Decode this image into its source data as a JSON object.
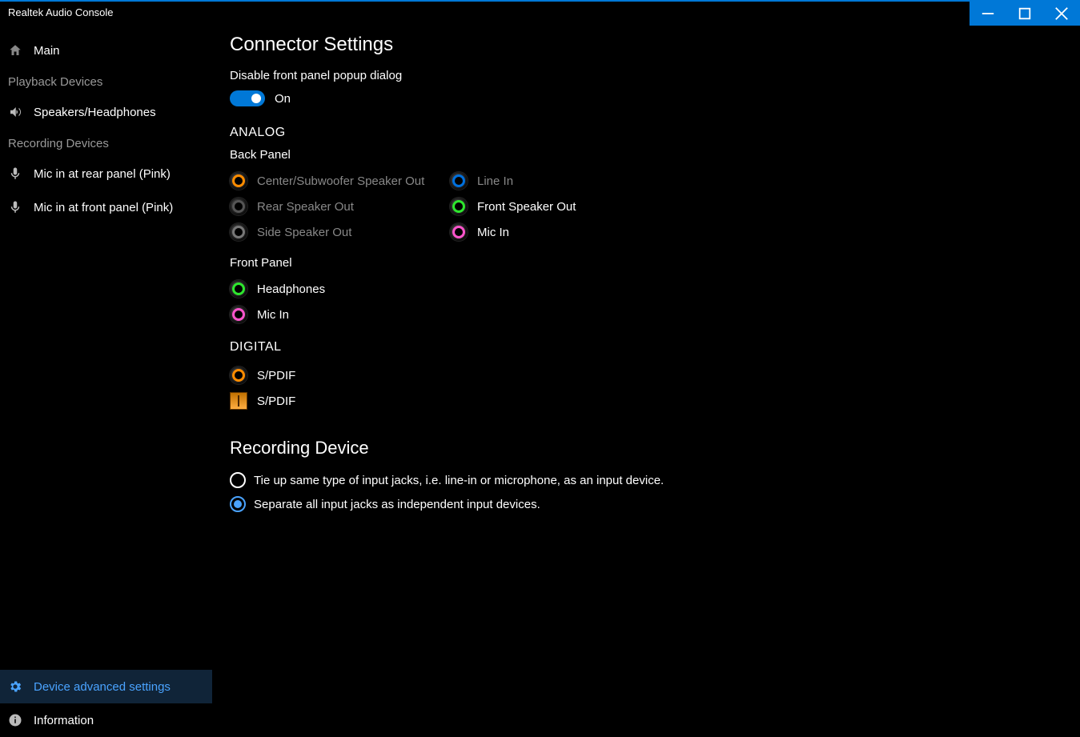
{
  "window": {
    "title": "Realtek Audio Console"
  },
  "sidebar": {
    "main": "Main",
    "playback_header": "Playback Devices",
    "playback_items": [
      "Speakers/Headphones"
    ],
    "recording_header": "Recording Devices",
    "recording_items": [
      "Mic in at rear panel (Pink)",
      "Mic in at front panel (Pink)"
    ],
    "advanced": "Device advanced settings",
    "information": "Information"
  },
  "content": {
    "title": "Connector Settings",
    "disable_popup_label": "Disable front panel popup dialog",
    "toggle_state": "On",
    "analog_header": "ANALOG",
    "back_panel_label": "Back Panel",
    "back_panel_left": [
      {
        "color": "orange",
        "label": "Center/Subwoofer Speaker Out",
        "active": false
      },
      {
        "color": "black",
        "label": "Rear Speaker Out",
        "active": false
      },
      {
        "color": "grey",
        "label": "Side Speaker Out",
        "active": false
      }
    ],
    "back_panel_right": [
      {
        "color": "blue",
        "label": "Line In",
        "active": false
      },
      {
        "color": "green",
        "label": "Front Speaker Out",
        "active": true
      },
      {
        "color": "pink",
        "label": "Mic In",
        "active": true
      }
    ],
    "front_panel_label": "Front Panel",
    "front_panel": [
      {
        "color": "green",
        "label": "Headphones",
        "active": true
      },
      {
        "color": "pink",
        "label": "Mic In",
        "active": true
      }
    ],
    "digital_header": "DIGITAL",
    "digital": [
      {
        "type": "jack",
        "color": "orange",
        "label": "S/PDIF"
      },
      {
        "type": "optical",
        "label": "S/PDIF"
      }
    ],
    "recording_title": "Recording Device",
    "recording_options": [
      {
        "label": "Tie up same type of input jacks, i.e. line-in or microphone, as an input device.",
        "checked": false
      },
      {
        "label": "Separate all input jacks as independent input devices.",
        "checked": true
      }
    ]
  }
}
